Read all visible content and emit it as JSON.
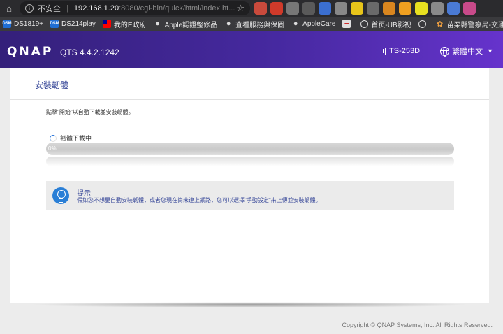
{
  "browser": {
    "security_label": "不安全",
    "url_host": "192.168.1.20",
    "url_path": ":8080/cgi-bin/quick/html/index.ht...",
    "bookmarks": [
      {
        "label": "DS1819+",
        "icon": "dsm-icon"
      },
      {
        "label": "DS214play",
        "icon": "dsm-icon"
      },
      {
        "label": "我的E政府",
        "icon": "flag-icon"
      },
      {
        "label": "Apple認證整修品",
        "icon": "apple-icon"
      },
      {
        "label": "查看服務與保固",
        "icon": "apple-icon"
      },
      {
        "label": "AppleCare",
        "icon": "apple-icon"
      },
      {
        "label": "",
        "icon": "bookmark-icon"
      },
      {
        "label": "首页-UB影视",
        "icon": "globe-icon"
      },
      {
        "label": "",
        "icon": "globe-icon"
      },
      {
        "label": "苗栗縣警察局-交通...",
        "icon": "flower-icon"
      }
    ],
    "extension_colors": [
      "#c94a3c",
      "#d03a2a",
      "#777777",
      "#5a5a5a",
      "#3b6fd1",
      "#888888",
      "#e8c51a",
      "#6a6a6a",
      "#d9861f",
      "#f0a020",
      "#e8e020",
      "#8a8a8a",
      "#4a7ad4",
      "#c84a8a"
    ]
  },
  "header": {
    "logo": "QNAP",
    "version": "QTS 4.4.2.1242",
    "model": "TS-253D",
    "language": "繁體中文"
  },
  "card": {
    "title": "安裝韌體",
    "instruction": "點擊\"開始\"以自動下載並安裝韌體。",
    "download_status": "韌體下載中...",
    "progress": {
      "percent": 0,
      "label": "0%"
    },
    "tip_title": "提示",
    "tip_text": "假如您不想要自動安裝韌體，或者您現在尚未連上網路，您可以選擇\"手動設定\"來上傳並安裝韌體。"
  },
  "footer": {
    "copyright": "Copyright © QNAP Systems, Inc. All Rights Reserved."
  },
  "colors": {
    "header_start": "#34207a",
    "header_end": "#6633cc",
    "accent_text": "#3a4a9a",
    "tip_icon": "#2a7fd6"
  }
}
